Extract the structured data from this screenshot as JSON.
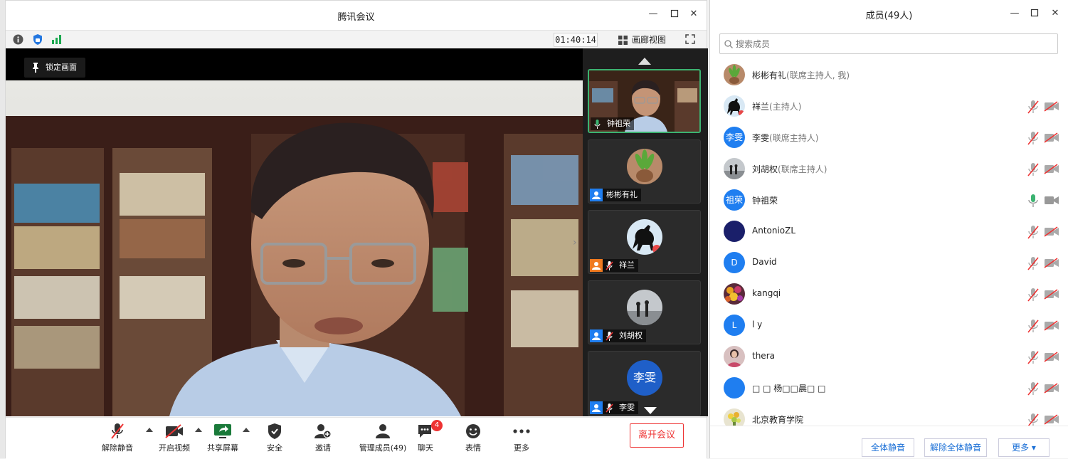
{
  "window": {
    "title": "腾讯会议"
  },
  "infobar": {
    "timer": "01:40:14",
    "gallery_label": "画廊视图"
  },
  "main_video": {
    "lock_label": "锁定画面"
  },
  "sidebar": {
    "tiles": [
      {
        "name": "钟祖荣",
        "state": "speaking"
      },
      {
        "name": "彬彬有礼",
        "state": "no-audio"
      },
      {
        "name": "祥兰",
        "state": "muted"
      },
      {
        "name": "刘胡权",
        "state": "muted"
      },
      {
        "name": "李雯",
        "state": "muted",
        "avatar_text": "李雯"
      }
    ]
  },
  "toolbar": {
    "items": [
      {
        "label": "解除静音",
        "icon": "mic-muted-icon"
      },
      {
        "label": "开启视频",
        "icon": "camera-off-icon"
      },
      {
        "label": "共享屏幕",
        "icon": "share-screen-icon"
      },
      {
        "label": "安全",
        "icon": "shield-icon"
      },
      {
        "label": "邀请",
        "icon": "invite-icon"
      },
      {
        "label": "管理成员(49)",
        "icon": "members-icon"
      },
      {
        "label": "聊天",
        "icon": "chat-icon",
        "badge": "4"
      },
      {
        "label": "表情",
        "icon": "emoji-icon"
      },
      {
        "label": "更多",
        "icon": "more-icon"
      }
    ],
    "leave_label": "离开会议"
  },
  "members_panel": {
    "title": "成员(49人)",
    "search_placeholder": "搜索成员",
    "members": [
      {
        "name": "彬彬有礼",
        "role": "(联席主持人, 我)",
        "avatar": "plant",
        "mic": "none",
        "cam": "none"
      },
      {
        "name": "祥兰",
        "role": "(主持人)",
        "avatar": "horse",
        "mic": "muted",
        "cam": "off"
      },
      {
        "name": "李雯",
        "role": "(联席主持人)",
        "avatar_text": "李雯",
        "avatar": "blue",
        "mic": "muted",
        "cam": "off"
      },
      {
        "name": "刘胡权",
        "role": "(联席主持人)",
        "avatar": "beach",
        "mic": "muted",
        "cam": "off"
      },
      {
        "name": "钟祖荣",
        "role": "",
        "avatar_text": "祖荣",
        "avatar": "blue",
        "mic": "active",
        "cam": "on"
      },
      {
        "name": "AntonioZL",
        "role": "",
        "avatar": "navy",
        "mic": "muted",
        "cam": "off"
      },
      {
        "name": "David",
        "role": "",
        "avatar_text": "D",
        "avatar": "blue",
        "mic": "muted",
        "cam": "off"
      },
      {
        "name": "kangqi",
        "role": "",
        "avatar": "flowers",
        "mic": "muted",
        "cam": "off"
      },
      {
        "name": "l y",
        "role": "",
        "avatar_text": "L",
        "avatar": "blue",
        "mic": "muted",
        "cam": "off"
      },
      {
        "name": "thera",
        "role": "",
        "avatar": "girl",
        "mic": "muted",
        "cam": "off"
      },
      {
        "name": "□ □ 杨□□晨□ □",
        "role": "",
        "avatar": "blue",
        "mic": "muted",
        "cam": "off"
      },
      {
        "name": "北京教育学院",
        "role": "",
        "avatar": "bouquet",
        "mic": "muted",
        "cam": "off"
      }
    ],
    "footer": {
      "mute_all": "全体静音",
      "unmute_all": "解除全体静音",
      "more": "更多 ▾"
    }
  },
  "colors": {
    "accent_blue": "#1a6fd6",
    "avatar_blue": "#1f7ef0",
    "danger": "#e33333",
    "speaking_green": "#3cb371"
  }
}
